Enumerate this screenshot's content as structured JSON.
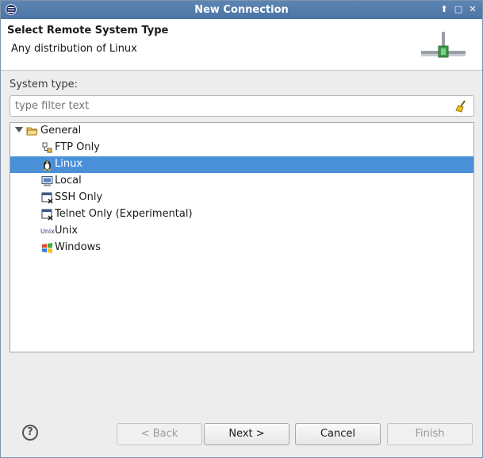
{
  "window": {
    "title": "New Connection"
  },
  "header": {
    "title": "Select Remote System Type",
    "description": "Any distribution of Linux"
  },
  "system_type": {
    "label": "System type:",
    "filter_placeholder": "type filter text"
  },
  "tree": {
    "root": {
      "label": "General",
      "icon": "folder-open-icon"
    },
    "items": [
      {
        "label": "FTP Only",
        "icon": "ftp-icon"
      },
      {
        "label": "Linux",
        "icon": "linux-penguin-icon"
      },
      {
        "label": "Local",
        "icon": "local-computer-icon"
      },
      {
        "label": "SSH Only",
        "icon": "ssh-terminal-icon"
      },
      {
        "label": "Telnet Only (Experimental)",
        "icon": "telnet-terminal-icon"
      },
      {
        "label": "Unix",
        "icon": "unix-icon",
        "icon_text": "Unix"
      },
      {
        "label": "Windows",
        "icon": "windows-icon"
      }
    ],
    "selected": "Linux"
  },
  "buttons": {
    "back": "< Back",
    "next": "Next >",
    "cancel": "Cancel",
    "finish": "Finish"
  },
  "colors": {
    "selection": "#4a90d9",
    "titlebar": "#5078a8"
  }
}
